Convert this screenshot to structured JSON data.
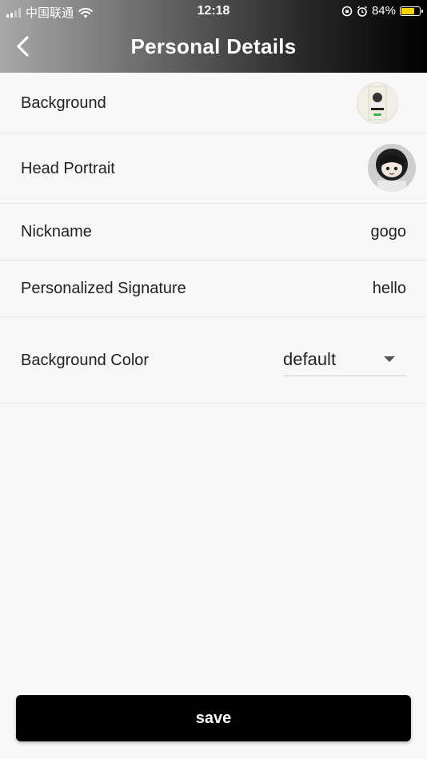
{
  "status_bar": {
    "carrier": "中国联通",
    "time": "12:18",
    "battery": "84%",
    "battery_level": 0.84
  },
  "header": {
    "title": "Personal Details",
    "back_icon": "chevron-left-icon"
  },
  "rows": {
    "background": {
      "label": "Background"
    },
    "head_portrait": {
      "label": "Head Portrait"
    },
    "nickname": {
      "label": "Nickname",
      "value": "gogo"
    },
    "signature": {
      "label": "Personalized Signature",
      "value": "hello"
    },
    "background_color": {
      "label": "Background Color",
      "selected": "default"
    }
  },
  "save_button": {
    "label": "save"
  },
  "colors": {
    "page_bg": "#f8f8f8",
    "button_bg": "#000000",
    "battery_fill": "#f5d200"
  }
}
